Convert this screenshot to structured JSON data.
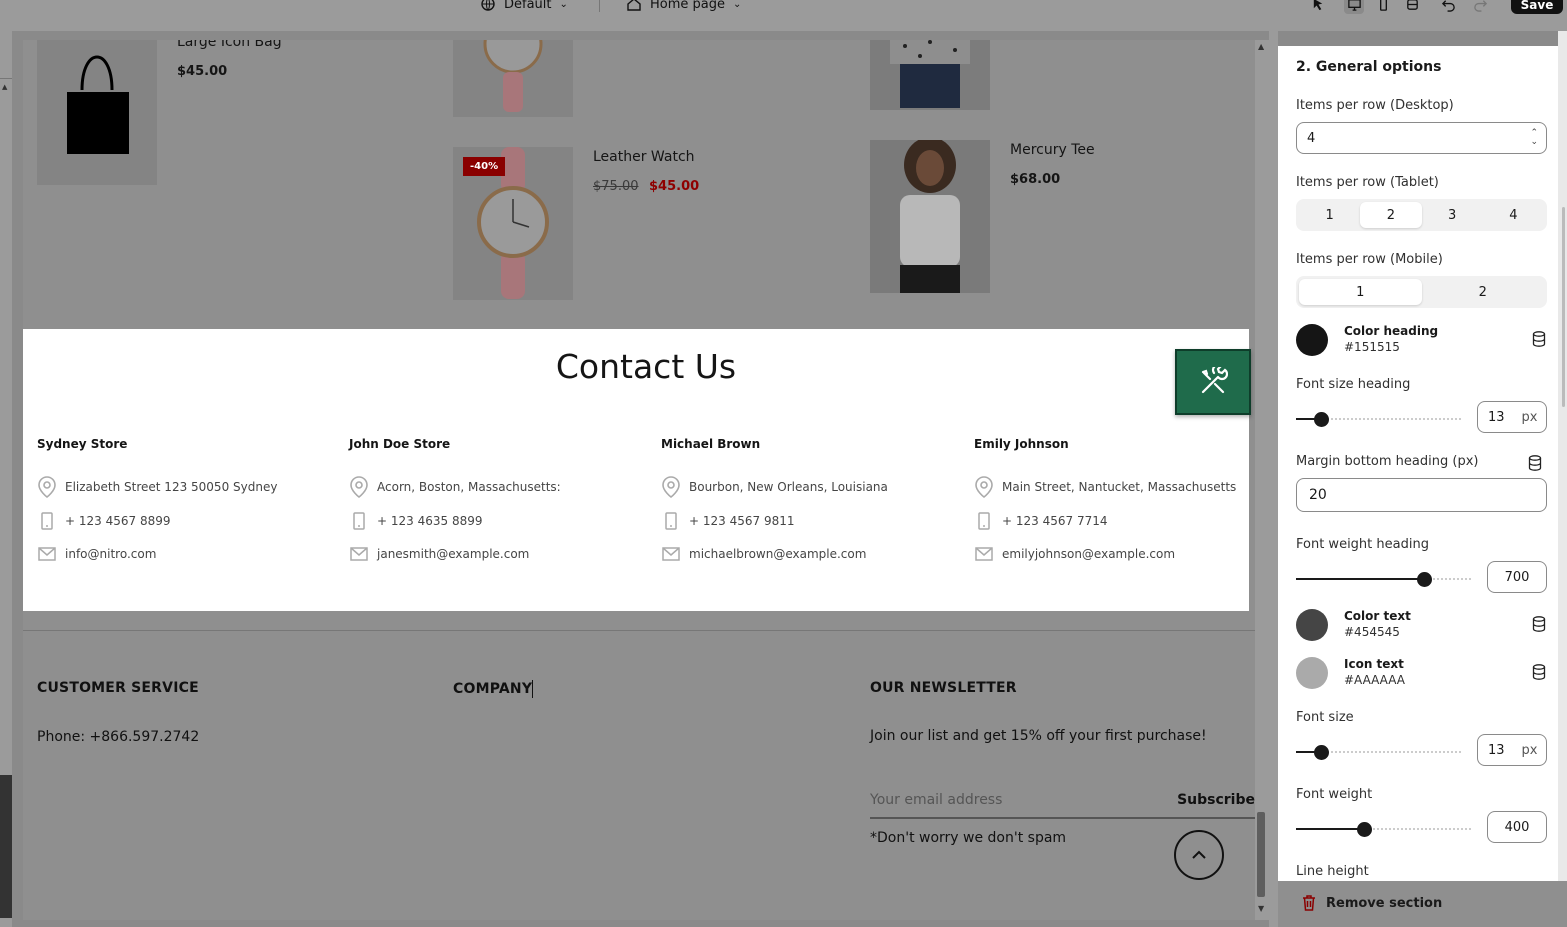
{
  "topbar": {
    "theme_label": "Default",
    "page_label": "Home page",
    "save_label": "Save"
  },
  "products": {
    "bag": {
      "name": "Large Icon Bag",
      "price": "$45.00"
    },
    "watch": {
      "name": "Leather Watch",
      "badge": "-40%",
      "old_price": "$75.00",
      "sale_price": "$45.00"
    },
    "tee": {
      "name": "Mercury Tee",
      "price": "$68.00"
    }
  },
  "contact": {
    "title": "Contact Us",
    "stores": [
      {
        "name": "Sydney Store",
        "address": "Elizabeth Street 123 50050 Sydney",
        "phone": "+ 123 4567 8899",
        "email": "info@nitro.com"
      },
      {
        "name": "John Doe Store",
        "address": "Acorn, Boston, Massachusetts:",
        "phone": "+ 123 4635 8899",
        "email": "janesmith@example.com"
      },
      {
        "name": "Michael Brown",
        "address": "Bourbon, New Orleans, Louisiana",
        "phone": "+ 123 4567 9811",
        "email": "michaelbrown@example.com"
      },
      {
        "name": "Emily Johnson",
        "address": "Main Street, Nantucket, Massachusetts",
        "phone": "+ 123 4567 7714",
        "email": "emilyjohnson@example.com"
      }
    ]
  },
  "footer": {
    "customer_service": {
      "heading": "CUSTOMER SERVICE",
      "phone": "Phone: +866.597.2742"
    },
    "company": {
      "heading": "COMPANY"
    },
    "newsletter": {
      "heading": "OUR NEWSLETTER",
      "text": "Join our list and get 15% off your first purchase!",
      "placeholder": "Your email address",
      "subscribe_label": "Subscribe",
      "note": "*Don't worry we don't spam"
    }
  },
  "panel": {
    "title": "2. General options",
    "items_desktop": {
      "label": "Items per row (Desktop)",
      "value": "4"
    },
    "items_tablet": {
      "label": "Items per row (Tablet)",
      "options": [
        "1",
        "2",
        "3",
        "4"
      ],
      "selected": "2"
    },
    "items_mobile": {
      "label": "Items per row (Mobile)",
      "options": [
        "1",
        "2"
      ],
      "selected": "1"
    },
    "color_heading": {
      "label": "Color heading",
      "value": "#151515"
    },
    "font_size_heading": {
      "label": "Font size heading",
      "value": "13",
      "unit": "px",
      "level": 0.15
    },
    "margin_bottom_heading": {
      "label": "Margin bottom heading (px)",
      "value": "20"
    },
    "font_weight_heading": {
      "label": "Font weight heading",
      "value": "700",
      "level": 0.73
    },
    "color_text": {
      "label": "Color text",
      "value": "#454545"
    },
    "icon_text": {
      "label": "Icon text",
      "value": "#AAAAAA"
    },
    "font_size": {
      "label": "Font size",
      "value": "13",
      "unit": "px",
      "level": 0.15
    },
    "font_weight": {
      "label": "Font weight",
      "value": "400",
      "level": 0.39
    },
    "line_height": {
      "label": "Line height"
    },
    "remove_label": "Remove section"
  },
  "colors": {
    "accent_green": "#1f6b4b",
    "sale_red": "#8f0000",
    "heading": "#151515",
    "text": "#454545",
    "icon": "#AAAAAA"
  }
}
